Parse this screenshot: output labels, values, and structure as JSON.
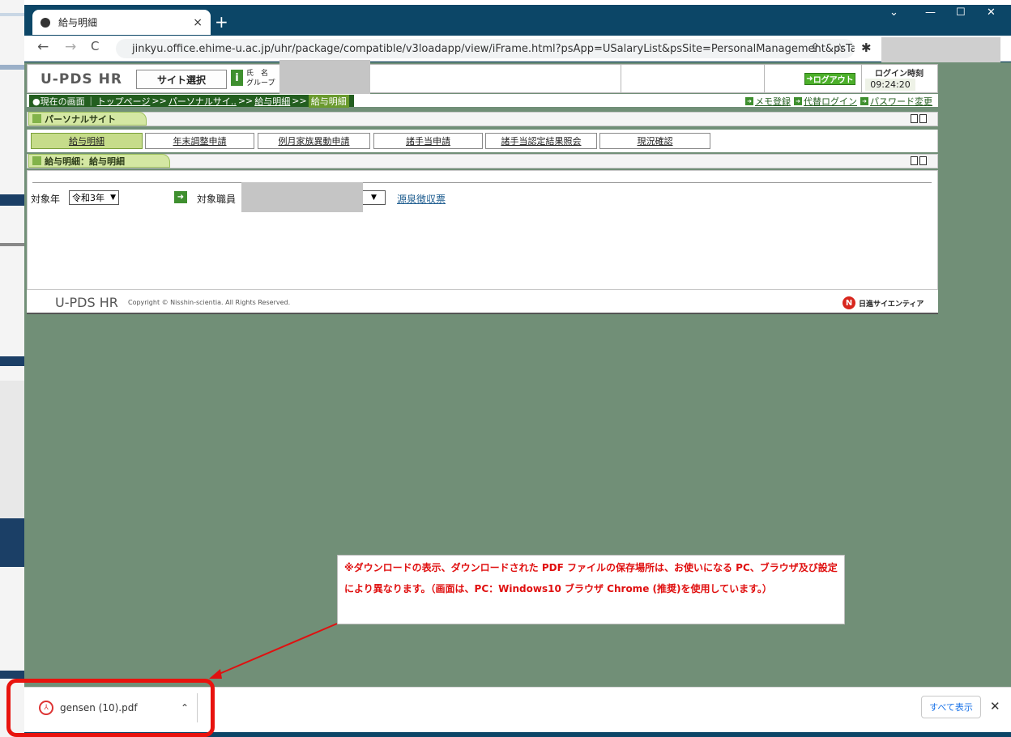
{
  "browser": {
    "tab_title": "給与明細",
    "tab_close": "×",
    "new_tab": "+",
    "url": "jinkyu.office.ehime-u.ac.jp/uhr/package/compatible/v3loadapp/view/iFrame.html?psApp=USalaryList&psSite=PersonalManagement&psTargetUser=0...",
    "window_controls": {
      "minimize": "—",
      "maximize": "☐",
      "close": "✕",
      "tabs_menu": "⌄"
    },
    "nav": {
      "back": "←",
      "forward": "→",
      "reload": "C"
    }
  },
  "app": {
    "logo": "U-PDS HR",
    "site_select": "サイト選択",
    "name_label": "氏　名",
    "group_label": "グループ",
    "logout": "ログアウト",
    "login_time_label": "ログイン時刻",
    "login_time": "09:24:20"
  },
  "breadcrumb": {
    "current_label": "●現在の画面",
    "items": [
      "トップページ",
      "パーソナルサイ..",
      "給与明細"
    ],
    "current": "給与明細",
    "sep": ">>"
  },
  "util_links": [
    "メモ登録",
    "代替ログイン",
    "パスワード変更"
  ],
  "sections": {
    "personal_site": "パーソナルサイト",
    "salary": "給与明細：給与明細"
  },
  "menu_tabs": [
    "給与明細",
    "年末調整申請",
    "例月家族異動申請",
    "諸手当申請",
    "諸手当認定結果照会",
    "現況確認"
  ],
  "form": {
    "year_label": "対象年",
    "year_value": "令和3年",
    "employee_label": "対象職員",
    "gensen_link": "源泉徴収票"
  },
  "footer": {
    "logo": "U-PDS HR",
    "copyright": "Copyright © Nisshin-scientia. All Rights Reserved.",
    "brand": "日進サイエンティア"
  },
  "note": {
    "text": "※ダウンロードの表示、ダウンロードされた PDF ファイルの保存場所は、お使いになる PC、ブラウザ及び設定により異なります。（画面は、PC：Windows10 ブラウザ Chrome (推奨)を使用しています。）"
  },
  "downloads": {
    "file_name": "gensen (10).pdf",
    "show_all": "すべて表示",
    "close": "✕"
  },
  "colors": {
    "titlebar": "#0c4667",
    "viewport": "#718f77",
    "accent_green": "#3f8f2f",
    "annotation_red": "#e01010"
  }
}
